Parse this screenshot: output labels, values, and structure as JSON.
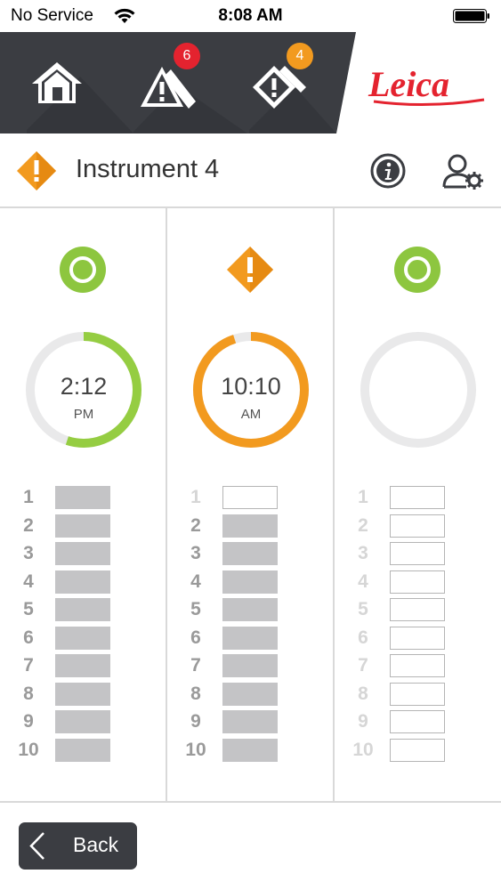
{
  "status_bar": {
    "carrier": "No Service",
    "time": "8:08 AM"
  },
  "nav": {
    "alerts_badge": "6",
    "warnings_badge": "4",
    "brand": "Leica",
    "colors": {
      "dark": "#3b3d42",
      "badge_red": "#e4232f",
      "badge_orange": "#f29a1f",
      "brand_red": "#e4232f"
    }
  },
  "header": {
    "title": "Instrument 4"
  },
  "columns": [
    {
      "status": "ok",
      "status_icon": "green-circle-icon",
      "time": "2:12",
      "ampm": "PM",
      "progress": 0.55,
      "ring_color": "#95cd42",
      "slots": [
        {
          "num": "1",
          "filled": true
        },
        {
          "num": "2",
          "filled": true
        },
        {
          "num": "3",
          "filled": true
        },
        {
          "num": "4",
          "filled": true
        },
        {
          "num": "5",
          "filled": true
        },
        {
          "num": "6",
          "filled": true
        },
        {
          "num": "7",
          "filled": true
        },
        {
          "num": "8",
          "filled": true
        },
        {
          "num": "9",
          "filled": true
        },
        {
          "num": "10",
          "filled": true
        }
      ]
    },
    {
      "status": "warning",
      "status_icon": "orange-warning-icon",
      "time": "10:10",
      "ampm": "AM",
      "progress": 0.95,
      "ring_color": "#f29a1f",
      "slots": [
        {
          "num": "1",
          "filled": false
        },
        {
          "num": "2",
          "filled": true
        },
        {
          "num": "3",
          "filled": true
        },
        {
          "num": "4",
          "filled": true
        },
        {
          "num": "5",
          "filled": true
        },
        {
          "num": "6",
          "filled": true
        },
        {
          "num": "7",
          "filled": true
        },
        {
          "num": "8",
          "filled": true
        },
        {
          "num": "9",
          "filled": true
        },
        {
          "num": "10",
          "filled": true
        }
      ]
    },
    {
      "status": "ok",
      "status_icon": "green-circle-icon",
      "time": "",
      "ampm": "",
      "progress": 0,
      "ring_color": "#95cd42",
      "slots": [
        {
          "num": "1",
          "filled": false
        },
        {
          "num": "2",
          "filled": false
        },
        {
          "num": "3",
          "filled": false
        },
        {
          "num": "4",
          "filled": false
        },
        {
          "num": "5",
          "filled": false
        },
        {
          "num": "6",
          "filled": false
        },
        {
          "num": "7",
          "filled": false
        },
        {
          "num": "8",
          "filled": false
        },
        {
          "num": "9",
          "filled": false
        },
        {
          "num": "10",
          "filled": false
        }
      ]
    }
  ],
  "footer": {
    "back_label": "Back"
  }
}
